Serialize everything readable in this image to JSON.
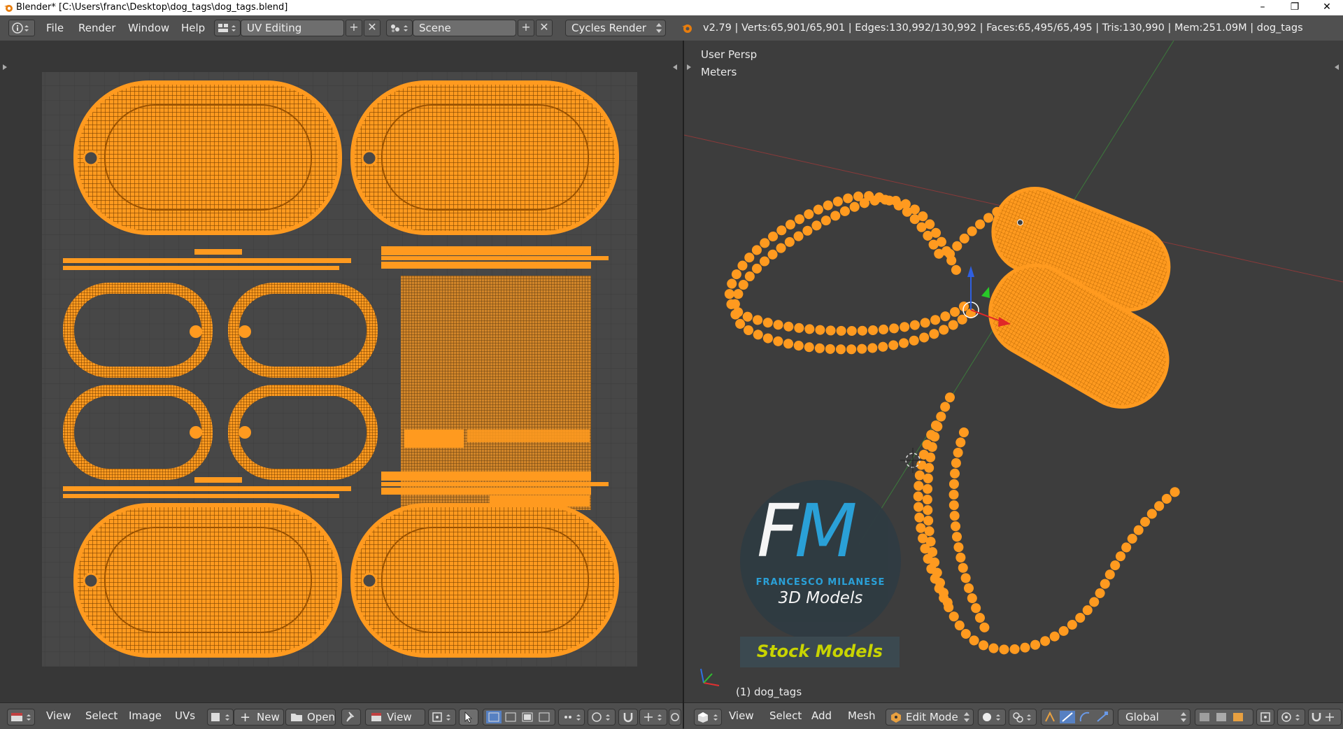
{
  "window": {
    "title": "Blender* [C:\\Users\\franc\\Desktop\\dog_tags\\dog_tags.blend]",
    "minimize": "–",
    "maximize": "❐",
    "close": "✕"
  },
  "info_header": {
    "menus": [
      "File",
      "Render",
      "Window",
      "Help"
    ],
    "screen_layout": "UV Editing",
    "scene": "Scene",
    "render_engine": "Cycles Render",
    "stats": "v2.79 | Verts:65,901/65,901 | Edges:130,992/130,992 | Faces:65,495/65,495 | Tris:130,990 | Mem:251.09M | dog_tags"
  },
  "viewport": {
    "view_name": "User Persp",
    "units": "Meters",
    "object_label": "(1) dog_tags"
  },
  "watermark": {
    "logo_letters": "FM",
    "author": "FRANCESCO MILANESE",
    "subtitle": "3D Models",
    "banner": "Stock Models"
  },
  "uv_header": {
    "menus": [
      "View",
      "Select",
      "Image",
      "UVs"
    ],
    "new_label": "New",
    "open_label": "Open",
    "view_label": "View"
  },
  "view3d_header": {
    "menus": [
      "View",
      "Select",
      "Add",
      "Mesh"
    ],
    "mode": "Edit Mode",
    "orientation": "Global"
  },
  "colors": {
    "mesh": "#ff9a1f",
    "grid_bg": "#474747",
    "accent": "#5680c2"
  }
}
